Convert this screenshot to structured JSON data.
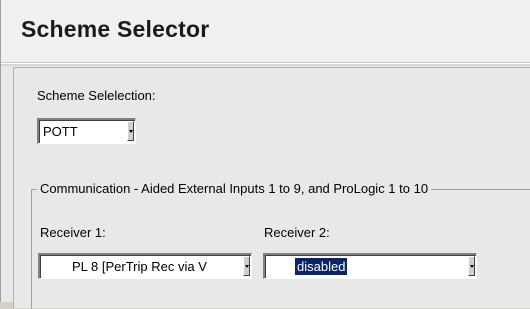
{
  "header": {
    "title": "Scheme Selector"
  },
  "scheme": {
    "label": "Scheme Selelection:",
    "value": "POTT"
  },
  "communication_group": {
    "title": "Communication - Aided External Inputs 1 to 9, and ProLogic 1 to 10",
    "receiver1": {
      "label": "Receiver 1:",
      "value": "PL 8 [PerTrip Rec via V"
    },
    "receiver2": {
      "label": "Receiver 2:",
      "value": "disabled"
    }
  },
  "icons": {
    "dropdown": "chevron-down-icon"
  }
}
